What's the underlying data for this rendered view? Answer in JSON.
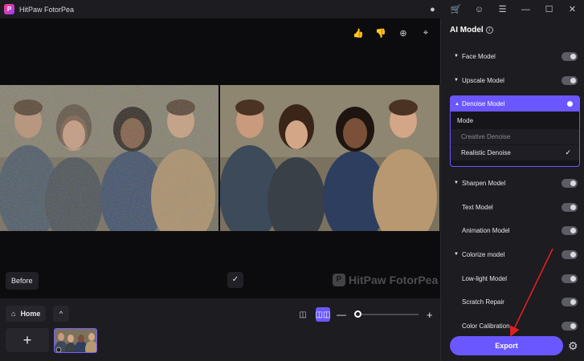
{
  "window": {
    "title": "HitPaw FotorPea",
    "logo_letter": "P"
  },
  "titlebar_icons": [
    "discord-icon",
    "cart-icon",
    "account-icon",
    "menu-icon",
    "minimize-icon",
    "maximize-icon",
    "close-icon"
  ],
  "canvas": {
    "before_label": "Before",
    "check_glyph": "✓",
    "watermark_text": "HitPaw FotorPea",
    "watermark_logo": "P"
  },
  "bottom_bar": {
    "home_label": "Home",
    "add_glyph": "+",
    "up_glyph": "^",
    "zoom_level": 0.0
  },
  "panel": {
    "title": "AI Model",
    "models": [
      {
        "label": "Face Model",
        "on": false,
        "group": true
      },
      {
        "label": "Upscale Model",
        "on": false,
        "group": true
      },
      {
        "label": "Denoise Model",
        "on": true,
        "group": true
      },
      {
        "label": "Sharpen Model",
        "on": false,
        "group": true
      },
      {
        "label": "Text Model",
        "on": false,
        "group": false
      },
      {
        "label": "Animation Model",
        "on": false,
        "group": false
      },
      {
        "label": "Colorize model",
        "on": false,
        "group": true
      },
      {
        "label": "Low-light Model",
        "on": false,
        "group": false
      },
      {
        "label": "Scratch Repair",
        "on": false,
        "group": false
      },
      {
        "label": "Color Calibration",
        "on": false,
        "group": false
      }
    ],
    "denoise": {
      "mode_label": "Mode",
      "options": [
        "Creative Denoise",
        "Realistic Denoise"
      ],
      "selected": "Realistic Denoise"
    },
    "export_label": "Export"
  },
  "colors": {
    "accent": "#6b57ff",
    "arrow": "#e02020"
  }
}
